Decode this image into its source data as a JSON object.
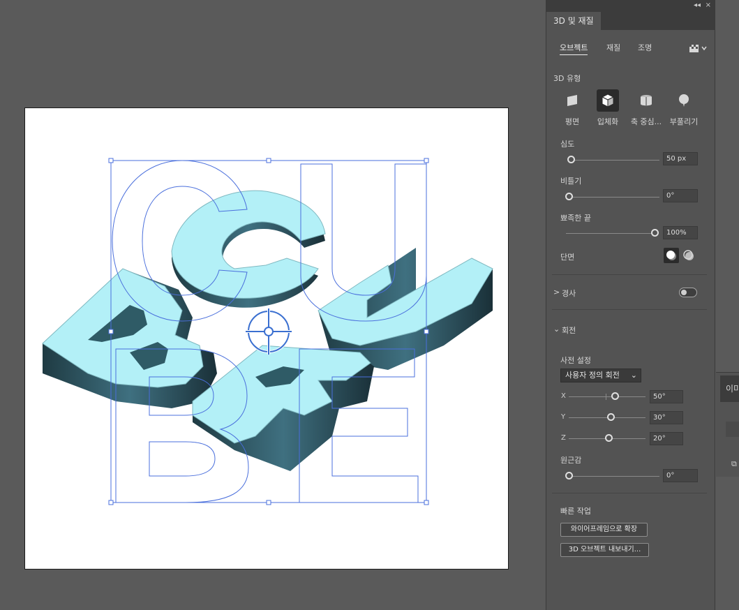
{
  "panel": {
    "title": "3D 및 재질",
    "collapse_icon": "double-chevron-left",
    "close_icon": "×",
    "tabs": [
      "오브젝트",
      "재질",
      "조명"
    ],
    "type_section": {
      "heading": "3D 유형",
      "types": [
        {
          "label": "평면",
          "icon": "plane-icon",
          "active": false
        },
        {
          "label": "입체화",
          "icon": "extrude-icon",
          "active": true
        },
        {
          "label": "축 중심...",
          "icon": "revolve-icon",
          "active": false
        },
        {
          "label": "부풀리기",
          "icon": "inflate-icon",
          "active": false
        }
      ]
    },
    "depth": {
      "label": "심도",
      "value": "50 px",
      "fraction": 0.0
    },
    "twist": {
      "label": "비틀기",
      "value": "0°",
      "fraction": 0.0
    },
    "taper": {
      "label": "뾰족한 끝",
      "value": "100%",
      "fraction": 1.0
    },
    "cap": {
      "label": "단면"
    },
    "bevel": {
      "label": "경사",
      "expander": ">",
      "enabled": false
    },
    "rotation": {
      "label": "회전",
      "expander": "v",
      "preset_label": "사전 설정",
      "preset_value": "사용자 정의 회전",
      "axes": [
        {
          "axis": "X",
          "value": "50°",
          "fraction": 0.64
        },
        {
          "axis": "Y",
          "value": "30°",
          "fraction": 0.58
        },
        {
          "axis": "Z",
          "value": "20°",
          "fraction": 0.56
        }
      ],
      "perspective": {
        "label": "원근감",
        "value": "0°",
        "fraction": 0.0
      }
    },
    "quick_actions": {
      "label": "빠른 작업",
      "buttons": [
        "와이어프레임으로 확장",
        "3D 오브젝트 내보내기..."
      ]
    }
  },
  "second_panel": {
    "tab_label": "이미"
  },
  "colors": {
    "face": "#b3f0f7",
    "side": "#2f5b66",
    "outline": "#4a6fdc",
    "canvas": "#5a5a5a",
    "panel": "#535353"
  },
  "artwork": {
    "letters": [
      "C",
      "U",
      "B",
      "E"
    ],
    "anchor_icon": "rotation-target-icon"
  }
}
